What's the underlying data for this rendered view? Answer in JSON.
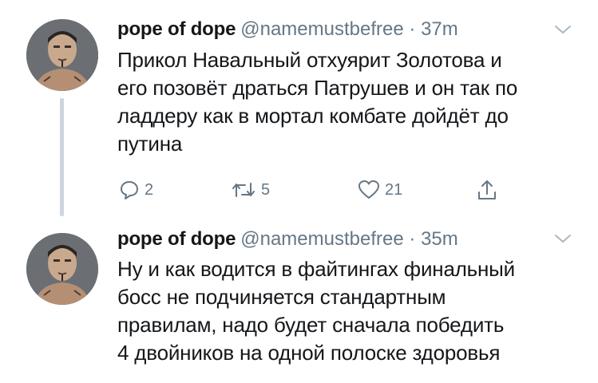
{
  "tweets": [
    {
      "name": "pope of dope",
      "handle": "@namemustbefree",
      "separator": "·",
      "time": "37m",
      "text": "Прикол Навальный отхуярит Золотова и\nего позовёт драться Патрушев и он так по\nладдеру как в мортал комбате дойдёт до\nпутина",
      "replies": "2",
      "retweets": "5",
      "likes": "21"
    },
    {
      "name": "pope of dope",
      "handle": "@namemustbefree",
      "separator": "·",
      "time": "35m",
      "text": "Ну и как водится в файтингах финальный\nбосс не подчиняется стандартным\nправилам, надо будет сначала победить\n4 двойников на одной полоске здоровья"
    }
  ],
  "icons": {
    "reply": "reply-icon",
    "retweet": "retweet-icon",
    "like": "heart-icon",
    "share": "share-icon",
    "menu": "chevron-down-icon"
  },
  "colors": {
    "text": "#14171a",
    "muted": "#657786",
    "thread_line": "#cdd6dd",
    "background": "#ffffff"
  }
}
